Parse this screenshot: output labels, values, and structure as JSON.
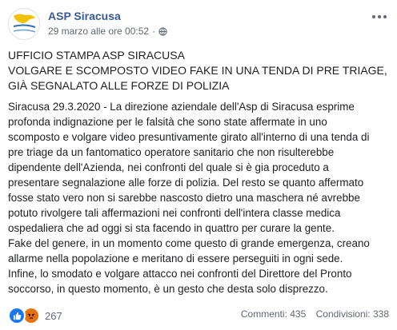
{
  "post": {
    "author": "ASP Siracusa",
    "timestamp": "29 marzo alle ore 00:52",
    "separator": "·",
    "avatar_text": "ASP SIRACUSA",
    "title_lines": [
      "UFFICIO STAMPA ASP SIRACUSA",
      "VOLGARE E SCOMPOSTO VIDEO FAKE IN UNA TENDA DI PRE TRIAGE,",
      "GIÀ SEGNALATO ALLE FORZE DI POLIZIA"
    ],
    "body_lines": [
      "Siracusa 29.3.2020 - La direzione aziendale dell'Asp di Siracusa esprime",
      "profonda indignazione per le falsità che sono state affermate in uno",
      "scomposto e volgare video presuntivamente girato all'interno di una tenda di",
      "pre triage da un fantomatico operatore sanitario che non risulterebbe",
      "dipendente dell'Azienda, nei confronti del quale si è gia proceduto a",
      "presentare segnalazione alle forze di polizia. Del resto se quanto affermato",
      "fosse stato vero non si sarebbe nascosto dietro una maschera né avrebbe",
      "potuto rivolgere tali affermazioni nei confronti dell'intera classe medica",
      "ospedaliera che ad oggi si sta facendo in quattro per curare la gente.",
      "Fake del genere, in un momento come questo di grande emergenza, creano",
      "allarme nella popolazione e meritano di essere perseguiti in ogni sede.",
      "Infine, lo smodato e volgare attacco nei confronti del Direttore del Pronto",
      "soccorso, in questo momento, è un gesto che desta solo disprezzo."
    ]
  },
  "footer": {
    "reaction_count": "267",
    "comments": "Commenti: 435",
    "shares": "Condivisioni: 338"
  },
  "icons": {
    "audience": "globe-icon",
    "menu": "more-options-icon",
    "reaction_1": "like-icon",
    "reaction_2": "angry-icon"
  },
  "colors": {
    "author_link": "#385898",
    "like": "#1877f2",
    "angry": "#e9710f",
    "meta": "#616770"
  }
}
